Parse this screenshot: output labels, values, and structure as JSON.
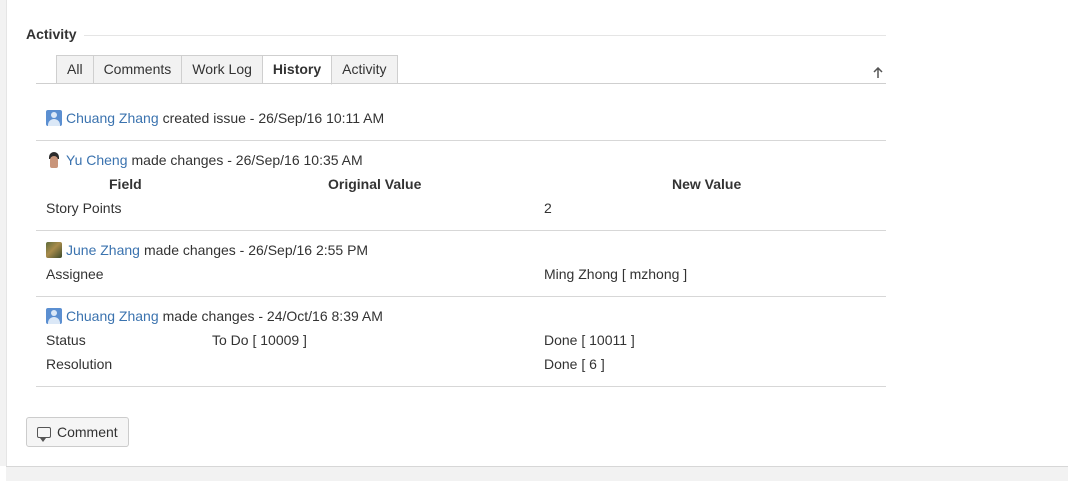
{
  "activity": {
    "title": "Activity",
    "tabs": [
      {
        "label": "All",
        "active": false
      },
      {
        "label": "Comments",
        "active": false
      },
      {
        "label": "Work Log",
        "active": false
      },
      {
        "label": "History",
        "active": true
      },
      {
        "label": "Activity",
        "active": false
      }
    ],
    "scroll_top_icon": "arrow-up-icon"
  },
  "history": {
    "entries": [
      {
        "user": "Chuang Zhang",
        "action": "created issue - 26/Sep/16 10:11 AM",
        "avatar": "default-user-avatar"
      },
      {
        "user": "Yu Cheng",
        "action": "made changes - 26/Sep/16 10:35 AM",
        "avatar": "photo-avatar",
        "headers": {
          "field": "Field",
          "original": "Original Value",
          "new": "New Value"
        },
        "changes": [
          {
            "field": "Story Points",
            "original": "",
            "new": "2"
          }
        ]
      },
      {
        "user": "June Zhang",
        "action": "made changes - 26/Sep/16 2:55 PM",
        "avatar": "photo-avatar",
        "changes": [
          {
            "field": "Assignee",
            "original": "",
            "new": "Ming Zhong [ mzhong ]"
          }
        ]
      },
      {
        "user": "Chuang Zhang",
        "action": "made changes - 24/Oct/16 8:39 AM",
        "avatar": "default-user-avatar",
        "changes": [
          {
            "field": "Status",
            "original": "To Do [ 10009 ]",
            "new": "Done [ 10011 ]"
          },
          {
            "field": "Resolution",
            "original": "",
            "new": "Done [ 6 ]"
          }
        ]
      }
    ]
  },
  "comment_button": {
    "label": "Comment",
    "icon": "comment-icon"
  },
  "colors": {
    "link": "#3b73af",
    "tab_bg": "#f2f2f2",
    "border": "#cfcfcf"
  }
}
